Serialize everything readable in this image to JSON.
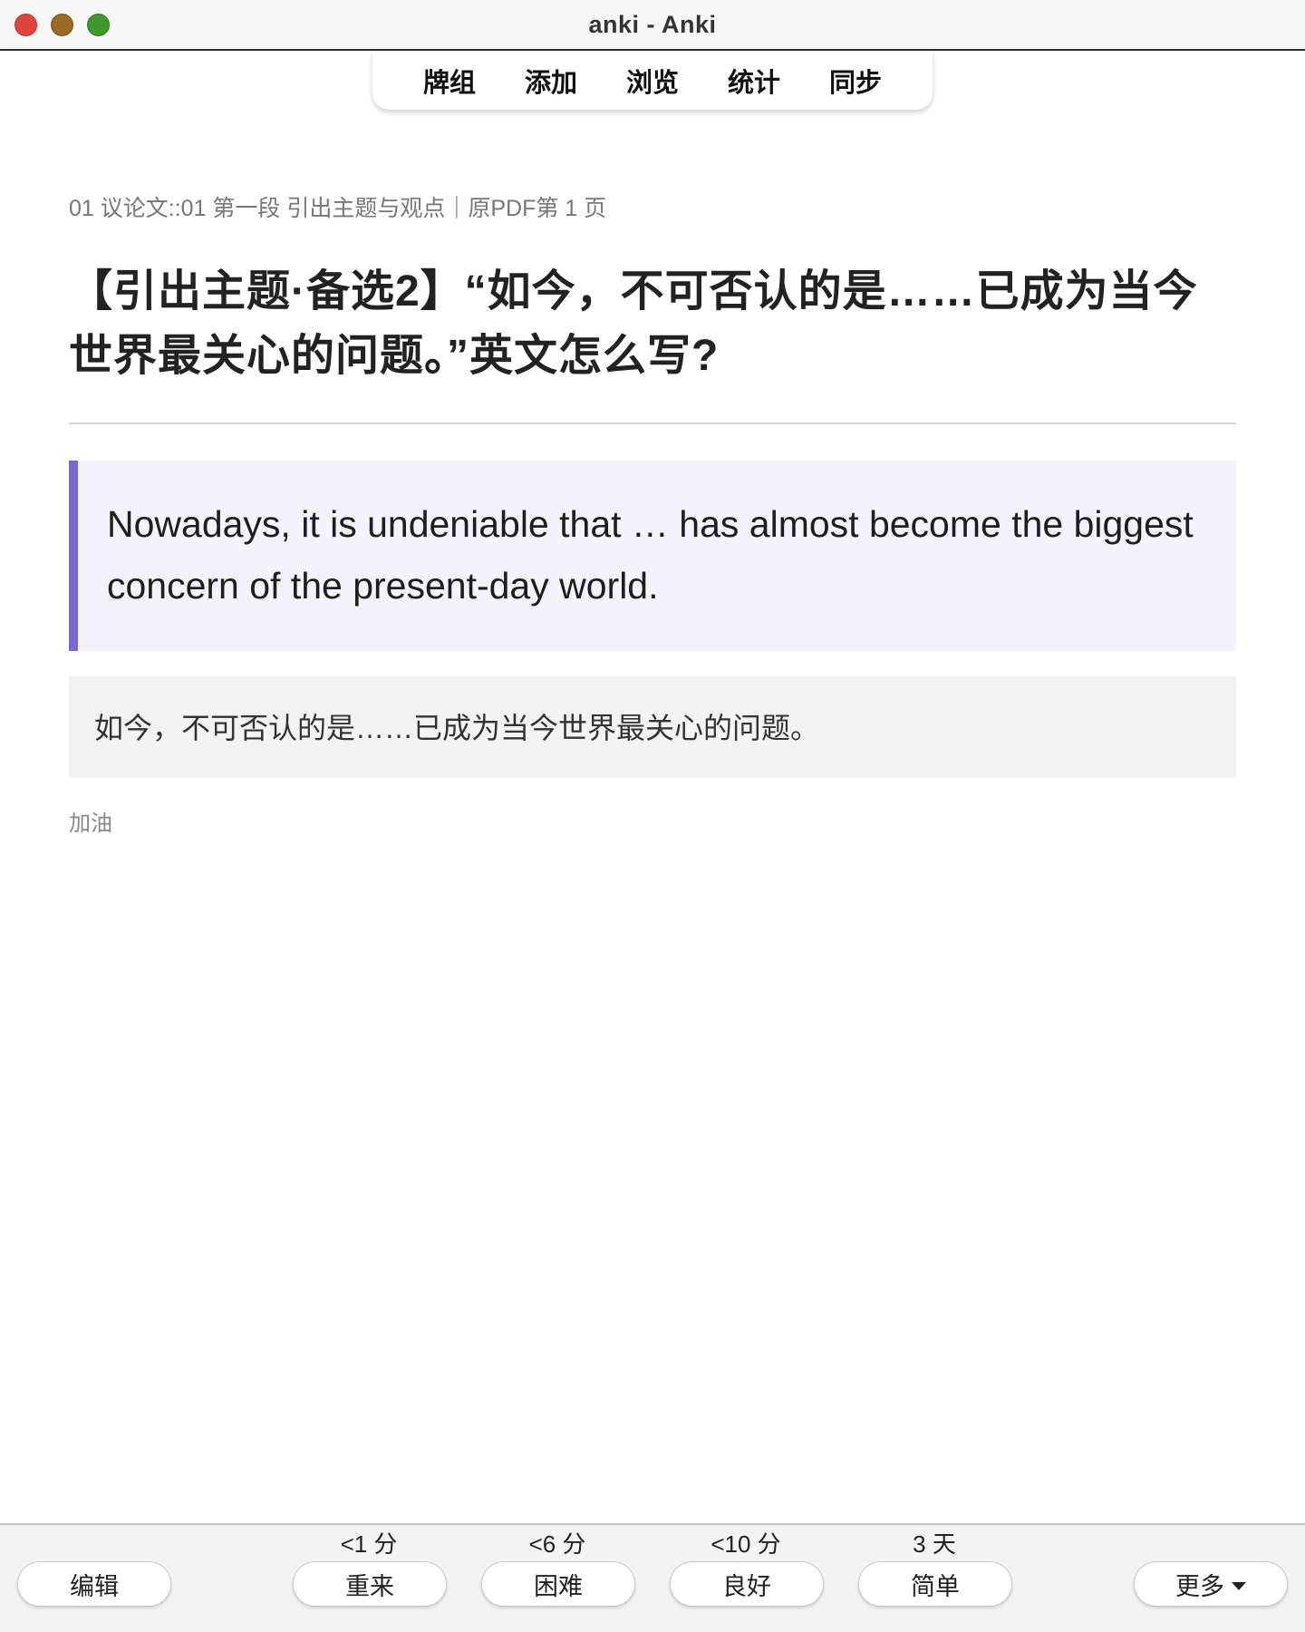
{
  "window": {
    "title": "anki - Anki"
  },
  "topnav": {
    "items": [
      {
        "label": "牌组"
      },
      {
        "label": "添加"
      },
      {
        "label": "浏览"
      },
      {
        "label": "统计"
      },
      {
        "label": "同步"
      }
    ]
  },
  "card": {
    "deck_path": "01 议论文::01 第一段 引出主题与观点｜原PDF第 1 页",
    "question": "【引出主题·备选2】“如今，不可否认的是……已成为当今世界最关心的问题。”英文怎么写?",
    "answer_en": "Nowadays, it is undeniable that … has almost become the biggest concern of the present-day world.",
    "answer_zh": "如今，不可否认的是……已成为当今世界最关心的问题。",
    "note": "加油"
  },
  "bottombar": {
    "edit_label": "编辑",
    "more_label": "更多",
    "answers": [
      {
        "interval": "<1 分",
        "label": "重来"
      },
      {
        "interval": "<6 分",
        "label": "困难"
      },
      {
        "interval": "<10 分",
        "label": "良好"
      },
      {
        "interval": "3 天",
        "label": "简单"
      }
    ]
  },
  "colors": {
    "accent_bar": "#7866d4",
    "answer_bg": "#f4f3fd",
    "close": "#e0443e",
    "minimize": "#9a6b22",
    "maximize": "#3e9a2b"
  }
}
